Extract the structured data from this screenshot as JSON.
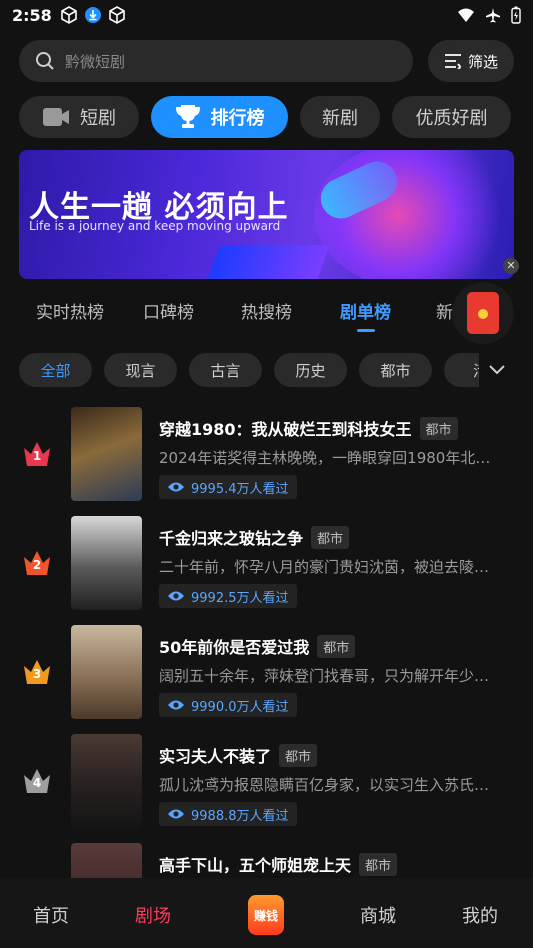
{
  "status": {
    "time": "2:58"
  },
  "search": {
    "placeholder": "黔微短剧"
  },
  "filter": {
    "label": "筛选"
  },
  "categories": [
    {
      "label": "短剧",
      "icon": "video-camera-icon",
      "active": false
    },
    {
      "label": "排行榜",
      "icon": "trophy-icon",
      "active": true
    },
    {
      "label": "新剧",
      "active": false
    },
    {
      "label": "优质好剧",
      "active": false
    }
  ],
  "banner": {
    "headline": "人生一趟  必须向上",
    "subline": "Life is a journey and  keep moving upward"
  },
  "rank_tabs": [
    "实时热榜",
    "口碑榜",
    "热搜榜",
    "剧单榜",
    "新剧"
  ],
  "rank_tab_active": "剧单榜",
  "genres": [
    "全部",
    "现言",
    "古言",
    "历史",
    "都市",
    "活"
  ],
  "genre_active": "全部",
  "dramas": [
    {
      "rank": "1",
      "title": "穿越1980：我从破烂王到科技女王",
      "tag": "都市",
      "desc": "2024年诺奖得主林晚晚，一睁眼穿回1980年北京…",
      "views": "9995.4万人看过",
      "crown_color": "#e8374f"
    },
    {
      "rank": "2",
      "title": "千金归来之玻钻之争",
      "tag": "都市",
      "desc": "二十年前，怀孕八月的豪门贵妇沈茵，被迫去陵…",
      "views": "9992.5万人看过",
      "crown_color": "#f0552d"
    },
    {
      "rank": "3",
      "title": "50年前你是否爱过我",
      "tag": "都市",
      "desc": "阔别五十余年，萍妹登门找春哥，只为解开年少…",
      "views": "9990.0万人看过",
      "crown_color": "#f29a1f"
    },
    {
      "rank": "4",
      "title": "实习夫人不装了",
      "tag": "都市",
      "desc": "孤儿沈鸢为报恩隐瞒百亿身家，以实习生入苏氏…",
      "views": "9988.8万人看过",
      "crown_color": "#9e9e9e"
    },
    {
      "rank": "",
      "title": "高手下山，五个师姐宠上天",
      "tag": "都市",
      "desc": "",
      "views": "",
      "crown_color": ""
    }
  ],
  "bottom_nav": {
    "home": "首页",
    "theater": "剧场",
    "earn": "赚钱",
    "mall": "商城",
    "mine": "我的"
  },
  "colors": {
    "accent": "#1e90ff",
    "active_red": "#ff3b5c"
  }
}
